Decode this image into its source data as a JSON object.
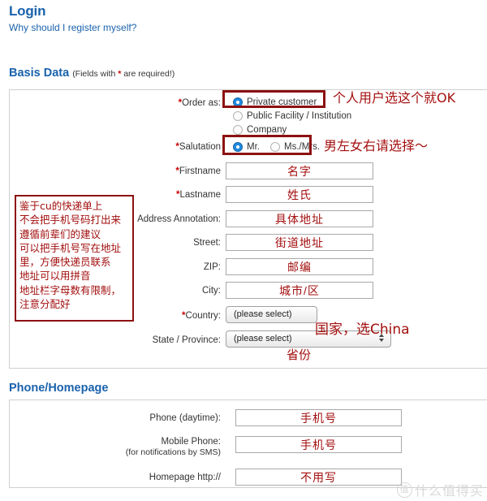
{
  "login": {
    "title": "Login",
    "subtitle": "Why should I register myself?"
  },
  "sections": {
    "basis": {
      "title": "Basis Data",
      "hint_pre": "(Fields with ",
      "hint_star": "*",
      "hint_post": " are required!)"
    },
    "phone": {
      "title": "Phone/Homepage"
    }
  },
  "basis": {
    "order_as": {
      "label": "Order as:",
      "required": true,
      "options": [
        {
          "label": "Private customer",
          "selected": true
        },
        {
          "label": "Public Facility / Institution",
          "selected": false
        },
        {
          "label": "Company",
          "selected": false
        }
      ]
    },
    "salutation": {
      "label": "Salutation",
      "required": true,
      "options": [
        {
          "label": "Mr.",
          "selected": true
        },
        {
          "label": "Ms./Mrs.",
          "selected": false
        }
      ]
    },
    "firstname": {
      "label": "Firstname",
      "required": true,
      "value": "名字"
    },
    "lastname": {
      "label": "Lastname",
      "required": true,
      "value": "姓氏"
    },
    "address_annotation": {
      "label": "Address Annotation:",
      "required": false,
      "value": "具体地址"
    },
    "street": {
      "label": "Street:",
      "required": false,
      "value": "街道地址"
    },
    "zip": {
      "label": "ZIP:",
      "required": false,
      "value": "邮编"
    },
    "city": {
      "label": "City:",
      "required": false,
      "value": "城市/区"
    },
    "country": {
      "label": "Country:",
      "required": true,
      "selected": "(please select)"
    },
    "state": {
      "label": "State / Province:",
      "required": false,
      "selected": "(please select)"
    }
  },
  "phone": {
    "daytime": {
      "label": "Phone (daytime):",
      "value": "手机号"
    },
    "mobile": {
      "label": "Mobile Phone:",
      "sublabel": "(for notifications by SMS)",
      "value": "手机号"
    },
    "homepage": {
      "label": "Homepage http://",
      "value": "不用写"
    }
  },
  "annotations": {
    "order_as": "个人用户选这个就OK",
    "salutation": "男左女右请选择～",
    "country": "国家，选China",
    "state": "省份",
    "note_lines": [
      "鉴于cu的快递单上",
      "不会把手机号码打出来",
      "遵循前辈们的建议",
      "可以把手机号写在地址",
      "里，方便快递员联系",
      "地址可以用拼音",
      "地址栏字母数有限制，",
      "注意分配好"
    ]
  },
  "watermark": {
    "mark": "值",
    "text": "什么值得买"
  },
  "colors": {
    "heading_blue": "#1a62ac",
    "annotation_red": "#a30f0f",
    "required_red": "#cc0000",
    "radio_selected": "#1f8ae0"
  }
}
